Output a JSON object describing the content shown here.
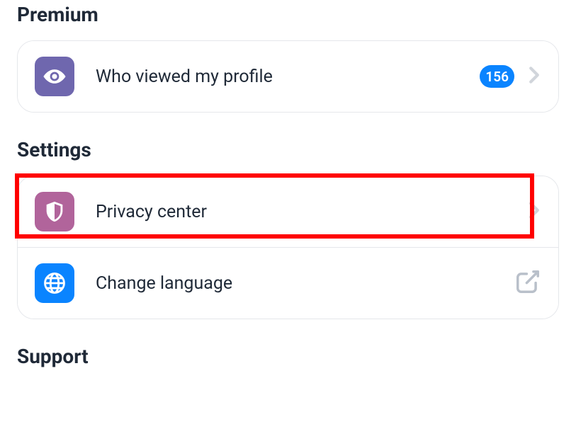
{
  "sections": {
    "premium": {
      "title": "Premium",
      "items": [
        {
          "label": "Who viewed my profile",
          "badge": "156",
          "icon": "eye",
          "icon_bg": "#6f67ae"
        }
      ]
    },
    "settings": {
      "title": "Settings",
      "items": [
        {
          "label": "Privacy center",
          "icon": "shield",
          "icon_bg": "#b1649b",
          "highlighted": true
        },
        {
          "label": "Change language",
          "icon": "globe",
          "icon_bg": "#0a84ff",
          "trailing": "external"
        }
      ]
    },
    "support": {
      "title": "Support"
    }
  }
}
